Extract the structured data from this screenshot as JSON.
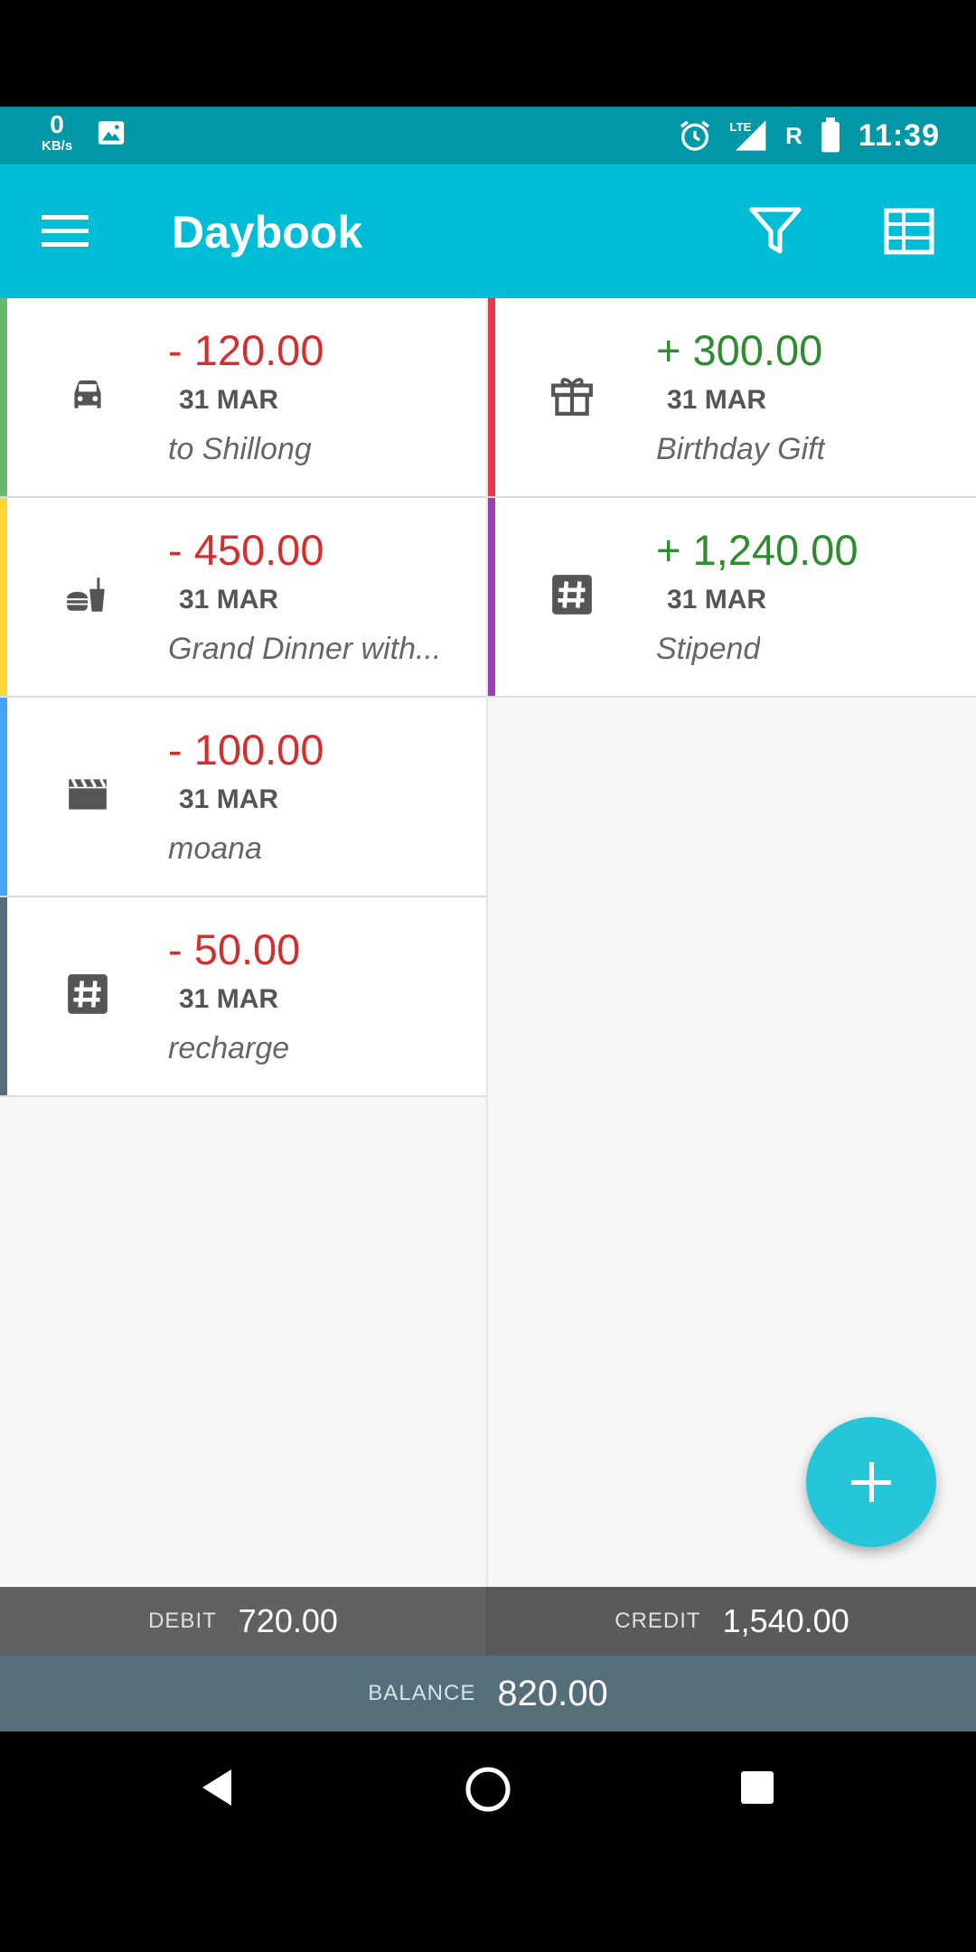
{
  "status_bar": {
    "net_speed_value": "0",
    "net_speed_unit": "KB/s",
    "roaming": "R",
    "time": "11:39",
    "icons": [
      "image-icon",
      "alarm-icon",
      "lte-signal-icon",
      "battery-icon"
    ]
  },
  "app_bar": {
    "title": "Daybook",
    "icons": [
      "menu-icon",
      "filter-icon",
      "grid-icon"
    ],
    "color": "#00BCD4"
  },
  "debits": [
    {
      "amount": "- 120.00",
      "date": "31 MAR",
      "note": "to Shillong",
      "icon": "car-icon",
      "stripe": "#66BB6A"
    },
    {
      "amount": "- 450.00",
      "date": "31 MAR",
      "note": "Grand Dinner with...",
      "icon": "food-icon",
      "stripe": "#FDD835"
    },
    {
      "amount": "- 100.00",
      "date": "31 MAR",
      "note": "moana",
      "icon": "movie-icon",
      "stripe": "#42A5F5"
    },
    {
      "amount": "- 50.00",
      "date": "31 MAR",
      "note": "recharge",
      "icon": "hashtag-icon",
      "stripe": "#546E7A"
    }
  ],
  "credits": [
    {
      "amount": "+ 300.00",
      "date": "31 MAR",
      "note": "Birthday Gift",
      "icon": "gift-icon",
      "stripe": "#E53950"
    },
    {
      "amount": "+ 1,240.00",
      "date": "31 MAR",
      "note": "Stipend",
      "icon": "hashtag-icon",
      "stripe": "#9C3FB0"
    }
  ],
  "totals": {
    "debit_label": "DEBIT",
    "debit_value": "720.00",
    "credit_label": "CREDIT",
    "credit_value": "1,540.00",
    "balance_label": "BALANCE",
    "balance_value": "820.00"
  },
  "colors": {
    "debit_text": "#D32F2F",
    "credit_text": "#2E8B2E",
    "fab": "#26C6DA"
  }
}
